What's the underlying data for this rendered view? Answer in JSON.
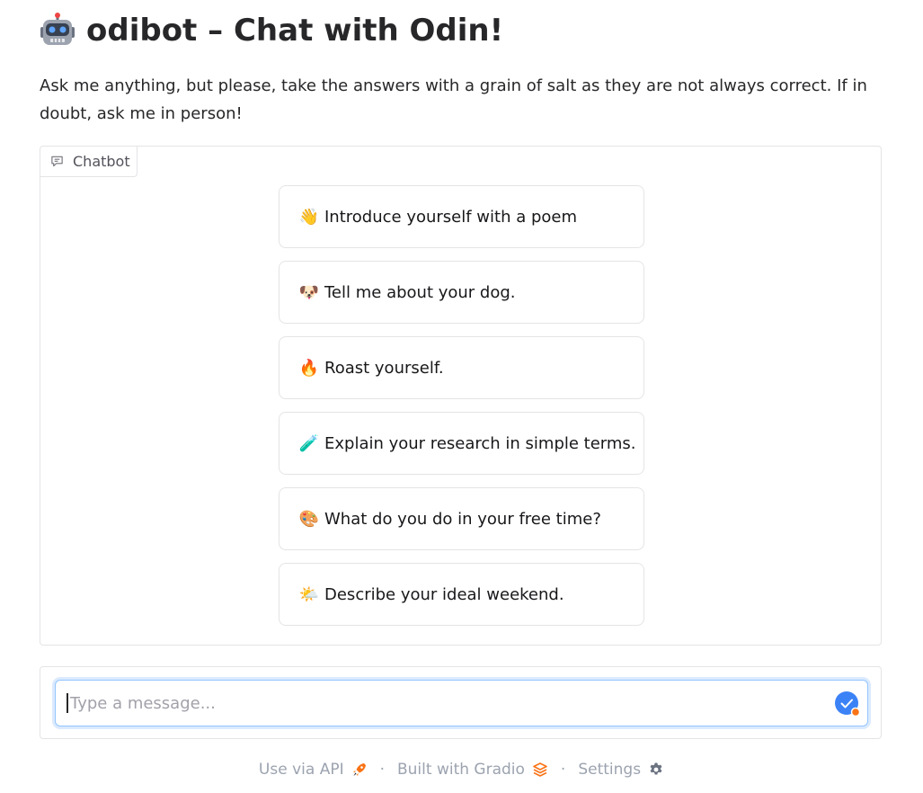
{
  "header": {
    "title": "odibot – Chat with Odin!",
    "description": "Ask me anything, but please, take the answers with a grain of salt as they are not always correct. If in doubt, ask me in person!"
  },
  "chatbot": {
    "label": "Chatbot",
    "examples": [
      {
        "icon": "waving-hand-icon",
        "emoji": "👋",
        "text": "Introduce yourself with a poem"
      },
      {
        "icon": "dog-face-icon",
        "emoji": "🐶",
        "text": "Tell me about your dog."
      },
      {
        "icon": "fire-icon",
        "emoji": "🔥",
        "text": "Roast yourself."
      },
      {
        "icon": "test-tube-icon",
        "emoji": "🧪",
        "text": "Explain your research in simple terms."
      },
      {
        "icon": "palette-icon",
        "emoji": "🎨",
        "text": "What do you do in your free time?"
      },
      {
        "icon": "sun-behind-cloud-icon",
        "emoji": "🌤️",
        "text": "Describe your ideal weekend."
      }
    ]
  },
  "input": {
    "value": "",
    "placeholder": "Type a message..."
  },
  "footer": {
    "api": "Use via API",
    "separator": "·",
    "built": "Built with Gradio",
    "settings": "Settings"
  },
  "colors": {
    "accent": "#f97316",
    "send": "#3b82f6",
    "border": "#e4e4e7"
  }
}
